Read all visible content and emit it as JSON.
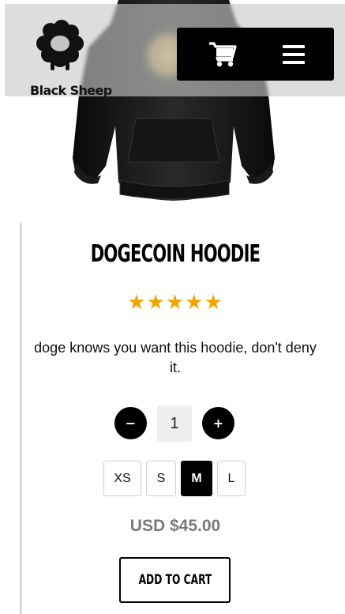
{
  "brand": {
    "name": "Black Sheep"
  },
  "header": {
    "cart_icon": "shopping-cart-icon",
    "menu_icon": "hamburger-menu-icon"
  },
  "product": {
    "title": "DOGECOIN HOODIE",
    "rating": {
      "value": 5,
      "max": 5,
      "glyphs": "★★★★★",
      "color": "#f0a500"
    },
    "description": "doge knows you want this hoodie, don't deny it.",
    "quantity": {
      "minus": "−",
      "value": "1",
      "plus": "+"
    },
    "sizes": [
      "XS",
      "S",
      "M",
      "L"
    ],
    "selected_size": "M",
    "price": "USD $45.00",
    "add_to_cart": "ADD TO CART"
  }
}
